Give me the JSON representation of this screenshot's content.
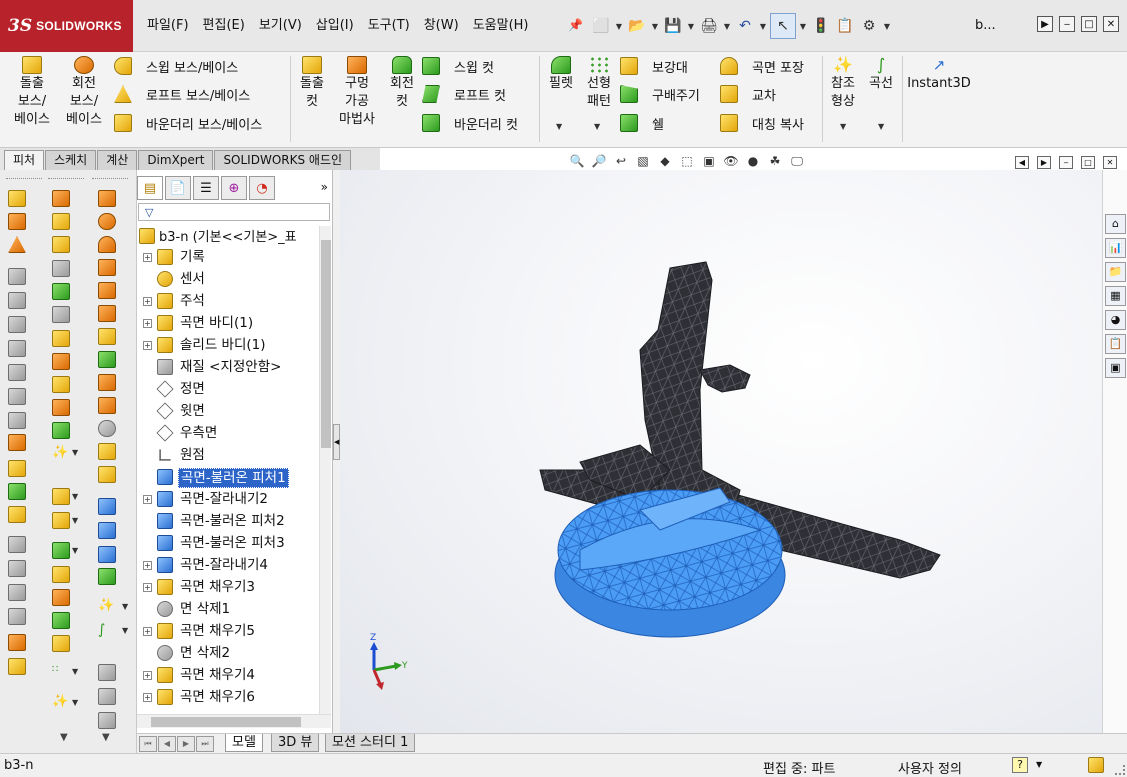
{
  "app": {
    "logo_prefix": "3S",
    "logo_text": "SOLIDWORKS",
    "file_short": "b...",
    "menus": [
      "파일(F)",
      "편집(E)",
      "보기(V)",
      "삽입(I)",
      "도구(T)",
      "창(W)",
      "도움말(H)"
    ]
  },
  "ribbon": {
    "extrude_boss": "돌출\n보스/\n베이스",
    "revolve_boss": "회전\n보스/\n베이스",
    "sweep_boss": "스윕 보스/베이스",
    "loft_boss": "로프트 보스/베이스",
    "boundary_boss": "바운더리 보스/베이스",
    "extrude_cut": "돌출\n컷",
    "hole_wizard": "구멍\n가공\n마법사",
    "revolve_cut": "회전\n컷",
    "sweep_cut": "스윕 컷",
    "loft_cut": "로프트 컷",
    "boundary_cut": "바운더리 컷",
    "fillet": "필렛",
    "linear_pattern": "선형\n패턴",
    "rib": "보강대",
    "draft": "구배주기",
    "shell": "쉘",
    "wrap": "곡면 포장",
    "intersect": "교차",
    "mirror": "대칭 복사",
    "ref_geometry": "참조\n형상",
    "curves": "곡선",
    "instant3d": "Instant3D"
  },
  "tabs": [
    "피처",
    "스케치",
    "계산",
    "DimXpert",
    "SOLIDWORKS 애드인"
  ],
  "feature_tree": {
    "root": "b3-n  (기본<<기본>_표",
    "items": [
      {
        "label": "기록",
        "icon": "history-icon",
        "expand": true
      },
      {
        "label": "센서",
        "icon": "sensor-icon",
        "expand": false
      },
      {
        "label": "주석",
        "icon": "annotation-icon",
        "expand": true
      },
      {
        "label": "곡면 바디(1)",
        "icon": "surface-body-icon",
        "expand": true
      },
      {
        "label": "솔리드 바디(1)",
        "icon": "solid-body-icon",
        "expand": true
      },
      {
        "label": "재질 <지정안함>",
        "icon": "material-icon",
        "expand": false
      },
      {
        "label": "정면",
        "icon": "plane-icon",
        "expand": false
      },
      {
        "label": "윗면",
        "icon": "plane-icon",
        "expand": false
      },
      {
        "label": "우측면",
        "icon": "plane-icon",
        "expand": false
      },
      {
        "label": "원점",
        "icon": "origin-icon",
        "expand": false
      },
      {
        "label": "곡면-불러온 피처1",
        "icon": "imported-surface-icon",
        "expand": false,
        "selected": true
      },
      {
        "label": "곡면-잘라내기2",
        "icon": "surface-trim-icon",
        "expand": true
      },
      {
        "label": "곡면-불러온 피처2",
        "icon": "imported-surface-icon",
        "expand": false
      },
      {
        "label": "곡면-불러온 피처3",
        "icon": "imported-surface-icon",
        "expand": false
      },
      {
        "label": "곡면-잘라내기4",
        "icon": "surface-trim-icon",
        "expand": true
      },
      {
        "label": "곡면 채우기3",
        "icon": "fill-surface-icon",
        "expand": true
      },
      {
        "label": "면 삭제1",
        "icon": "delete-face-icon",
        "expand": false
      },
      {
        "label": "곡면 채우기5",
        "icon": "fill-surface-icon",
        "expand": true
      },
      {
        "label": "면 삭제2",
        "icon": "delete-face-icon",
        "expand": false
      },
      {
        "label": "곡면 채우기4",
        "icon": "fill-surface-icon",
        "expand": true
      },
      {
        "label": "곡면 채우기6",
        "icon": "fill-surface-icon",
        "expand": true
      }
    ]
  },
  "bottom_tabs": [
    "모델",
    "3D 뷰",
    "모션 스터디 1"
  ],
  "status": {
    "file": "b3-n",
    "mode": "편집 중: 파트",
    "units": "사용자 정의",
    "help": "?"
  },
  "triad": {
    "x": "X",
    "y": "Y",
    "z": "Z"
  },
  "colors": {
    "brand": "#b8232b",
    "selection": "#2c64c8",
    "selected_mesh": "#4a9cf5",
    "mesh": "#2f3036"
  }
}
